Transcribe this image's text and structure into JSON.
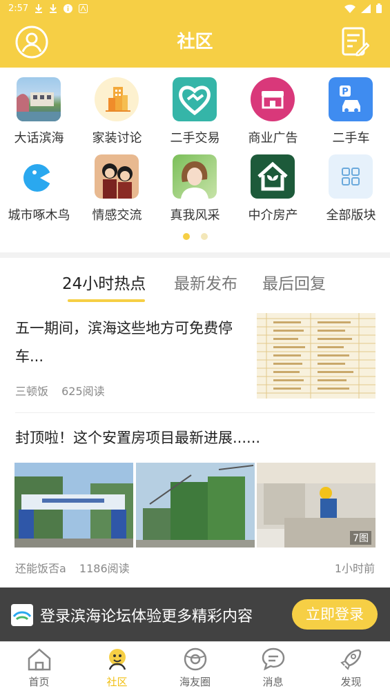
{
  "status_bar": {
    "time": "2:57"
  },
  "header": {
    "title": "社区"
  },
  "categories": [
    {
      "label": "大话滨海",
      "icon": "lakeside-photo-icon"
    },
    {
      "label": "家装讨论",
      "icon": "building-icon"
    },
    {
      "label": "二手交易",
      "icon": "heart-handshake-icon"
    },
    {
      "label": "商业广告",
      "icon": "storefront-icon"
    },
    {
      "label": "二手车",
      "icon": "parking-car-icon"
    },
    {
      "label": "城市啄木鸟",
      "icon": "bird-icon"
    },
    {
      "label": "情感交流",
      "icon": "couple-illustration-icon"
    },
    {
      "label": "真我风采",
      "icon": "portrait-photo-icon"
    },
    {
      "label": "中介房产",
      "icon": "house-plant-icon"
    },
    {
      "label": "全部版块",
      "icon": "grid-icon"
    }
  ],
  "tabs": [
    {
      "label": "24小时热点",
      "active": true
    },
    {
      "label": "最新发布",
      "active": false
    },
    {
      "label": "最后回复",
      "active": false
    }
  ],
  "posts": [
    {
      "title": "五一期间，滨海这些地方可免费停车...",
      "author": "三顿饭",
      "reads": "625阅读"
    },
    {
      "title": "封顶啦！这个安置房项目最新进展......",
      "author": "还能饭否a",
      "reads": "1186阅读",
      "time": "1小时前",
      "image_count": "7图"
    }
  ],
  "banner": {
    "text": "登录滨海论坛体验更多精彩内容",
    "button": "立即登录"
  },
  "bottom_nav": [
    {
      "label": "首页",
      "active": false,
      "icon": "home-icon"
    },
    {
      "label": "社区",
      "active": true,
      "icon": "community-mascot-icon"
    },
    {
      "label": "海友圈",
      "active": false,
      "icon": "circle-planet-icon"
    },
    {
      "label": "消息",
      "active": false,
      "icon": "message-bubble-icon"
    },
    {
      "label": "发现",
      "active": false,
      "icon": "rocket-icon"
    }
  ],
  "colors": {
    "brand": "#f6cf45",
    "active_nav": "#f1bf12"
  }
}
